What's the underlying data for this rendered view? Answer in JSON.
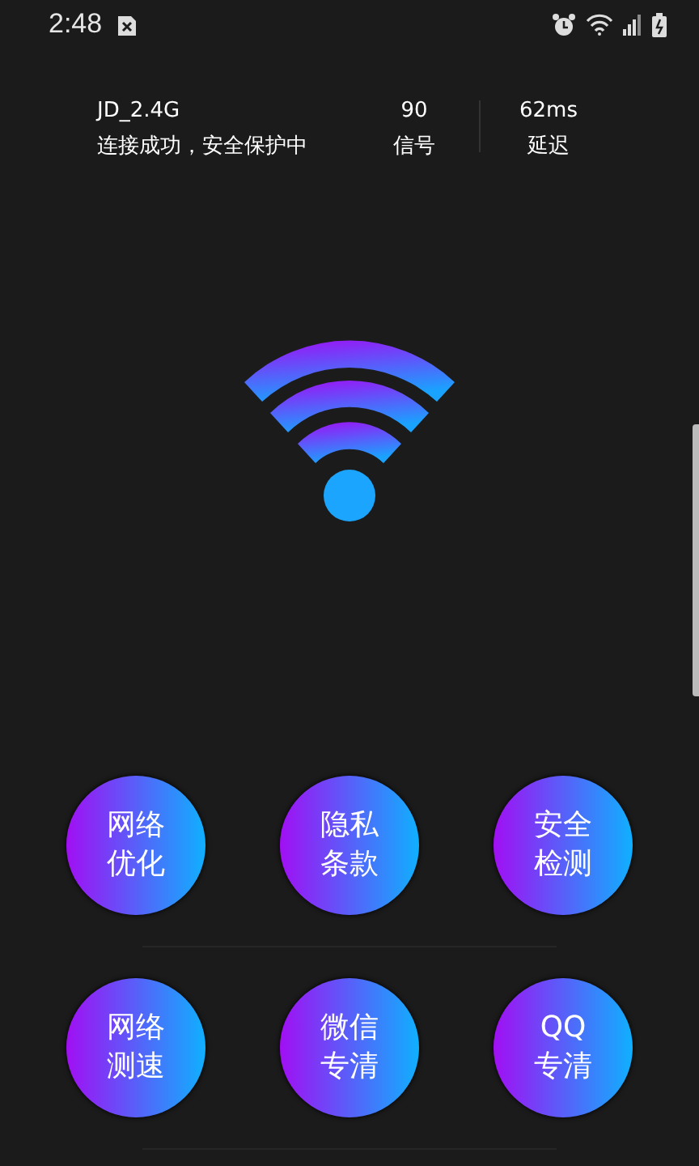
{
  "status_bar": {
    "time": "2:48"
  },
  "connection": {
    "ssid": "JD_2.4G",
    "status": "连接成功，安全保护中",
    "signal_value": "90",
    "signal_label": "信号",
    "latency_value": "62ms",
    "latency_label": "延迟"
  },
  "actions": [
    {
      "lines": [
        "网络",
        "优化"
      ]
    },
    {
      "lines": [
        "隐私",
        "条款"
      ]
    },
    {
      "lines": [
        "安全",
        "检测"
      ]
    },
    {
      "lines": [
        "网络",
        "测速"
      ]
    },
    {
      "lines": [
        "微信",
        "专清"
      ]
    },
    {
      "lines": [
        "QQ",
        "专清"
      ]
    }
  ]
}
